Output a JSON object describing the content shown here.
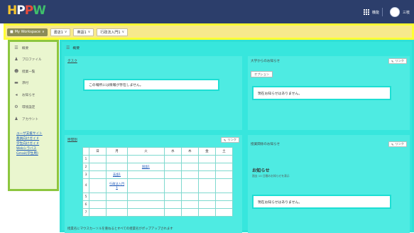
{
  "header": {
    "logo": {
      "p1": "H",
      "p2": "P",
      "p3": "P",
      "p4": "W"
    },
    "right": {
      "grid_label": "機能",
      "user_label": "三枝"
    }
  },
  "workspace_nav": {
    "workspace_button": "My Workspace",
    "tabs": [
      "書店1",
      "英語1",
      "行政法入門1"
    ]
  },
  "sidebar": {
    "items": [
      {
        "label": "概要",
        "icon": "list-icon"
      },
      {
        "label": "プロファイル",
        "icon": "person-icon"
      },
      {
        "label": "授業一覧",
        "icon": "people-icon"
      },
      {
        "label": "添付",
        "icon": "folder-icon"
      },
      {
        "label": "お知らせ",
        "icon": "megaphone-icon"
      },
      {
        "label": "環境設定",
        "icon": "gear-icon"
      },
      {
        "label": "アカウント",
        "icon": "person-icon"
      }
    ],
    "links": [
      "ユーザ支援サイト",
      "教員向けガイド",
      "学生向けガイド",
      "Webシラバス",
      "Gmail(学生用)"
    ]
  },
  "main": {
    "title": "概要",
    "task_panel": {
      "head": "タスク",
      "link": "リンク",
      "message": "この場所には情報が存在しません。"
    },
    "univ_panel": {
      "head": "大学からのお知らせ",
      "link": "リンク",
      "option": "オプション",
      "message": "現在お知らせはありません。"
    },
    "timetable_panel": {
      "head": "時間割",
      "link": "リンク",
      "days": [
        "日",
        "月",
        "火",
        "水",
        "木",
        "金",
        "土"
      ],
      "periods": [
        "1",
        "2",
        "3",
        "4",
        "5",
        "6",
        "7"
      ],
      "classes": {
        "2_tue": "国語1",
        "3_mon": "英語1",
        "4_mon": "行政法入門1"
      },
      "footnote": "授業名にマウスカーソルを重ねるとすべての授業名がポップアップされます"
    },
    "sub_notice_panel": {
      "head": "授業関係のお知らせ",
      "link": "リンク",
      "title": "お知らせ",
      "subtitle": "過去 10 日間のお知らせを表示",
      "message": "現在お知らせはありません。"
    }
  }
}
